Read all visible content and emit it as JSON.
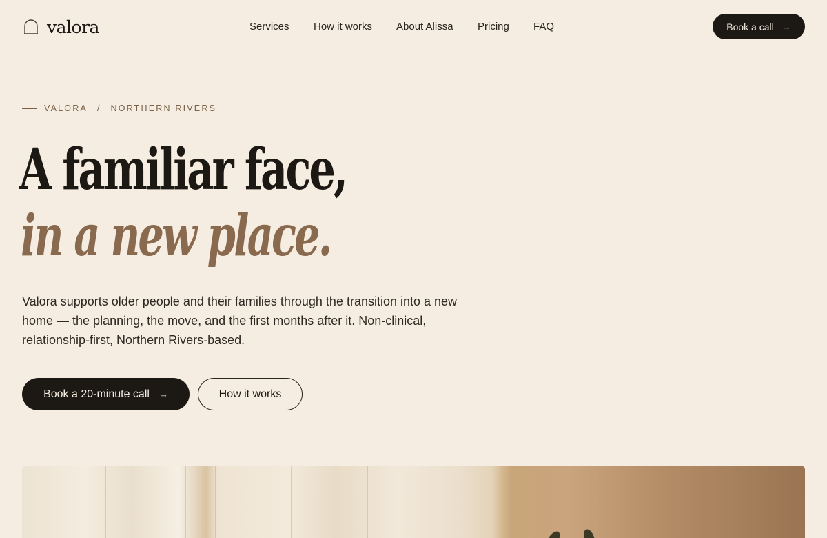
{
  "brand": {
    "name": "valora",
    "logo_icon": "bell-arch-outline-icon"
  },
  "nav": {
    "items": [
      {
        "label": "Services"
      },
      {
        "label": "How it works"
      },
      {
        "label": "About Alissa"
      },
      {
        "label": "Pricing"
      },
      {
        "label": "FAQ"
      }
    ],
    "cta_label": "Book a call",
    "cta_arrow": "→"
  },
  "eyebrow": {
    "part1": "VALORA",
    "separator": "/",
    "part2": "NORTHERN RIVERS"
  },
  "hero": {
    "headline_line1": "A familiar face,",
    "headline_line2": "in a new place.",
    "description": "Valora supports older people and their families through the transition into a new home — the planning, the move, and the first months after it. Non-clinical, relationship-first, Northern Rivers-based.",
    "primary_cta": "Book a 20-minute call",
    "primary_cta_arrow": "→",
    "secondary_cta": "How it works"
  },
  "colors": {
    "background": "#f5ede1",
    "ink": "#1c1814",
    "accent_brown": "#8a6a4f",
    "eyebrow_brown": "#7a6148"
  }
}
